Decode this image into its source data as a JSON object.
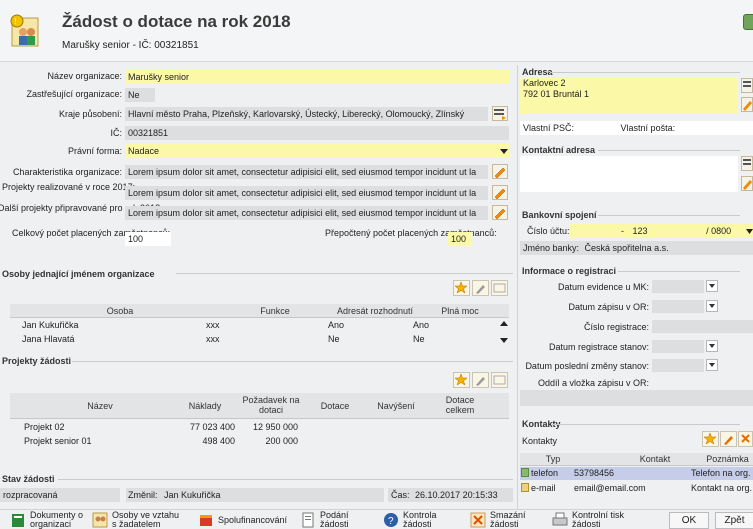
{
  "header": {
    "title": "Žádost o dotace na rok 2018",
    "subtitle": "Marušky senior - IČ: 00321851"
  },
  "org": {
    "nazev_label": "Název organizace:",
    "nazev": "Marušky senior",
    "zastr_label": "Zastřešující organizace:",
    "zastr": "Ne",
    "kraje_label": "Kraje působení:",
    "kraje": "Hlavní město Praha, Plzeňský, Karlovarský, Ústecký, Liberecký, Olomoucký, Zlínský",
    "ic_label": "IČ:",
    "ic": "00321851",
    "forma_label": "Právní forma:",
    "forma": "Nadace",
    "char_label": "Charakteristika organizace:",
    "char": "Lorem ipsum dolor sit amet, consectetur adipisici elit, sed eiusmod tempor incidunt ut la",
    "proj_label": "Projekty realizované v roce 2017:",
    "proj": "Lorem ipsum dolor sit amet, consectetur adipisici elit, sed eiusmod tempor incidunt ut la",
    "dalsi_label": "Další projekty připravované pro rok 2018:",
    "dalsi": "Lorem ipsum dolor sit amet, consectetur adipisici elit, sed eiusmod tempor incidunt ut la",
    "celk_label": "Celkový počet placených zaměstnanců:",
    "celk": "100",
    "prep_label": "Přepočtený počet placených zaměstnanců:",
    "prep": "100"
  },
  "osoby": {
    "title": "Osoby jednající jménem organizace",
    "cols": [
      "Osoba",
      "Funkce",
      "Adresát rozhodnutí",
      "Plná moc"
    ],
    "rows": [
      [
        "Jan Kukuřička",
        "xxx",
        "Ano",
        "Ano"
      ],
      [
        "Jana Hlavatá",
        "xxx",
        "Ne",
        "Ne"
      ]
    ]
  },
  "projekty": {
    "title": "Projekty žádosti",
    "cols": [
      "Název",
      "Náklady",
      "Požadavek na dotaci",
      "Dotace",
      "Navýšení",
      "Dotace celkem"
    ],
    "rows": [
      [
        "Projekt 02",
        "77 023 400",
        "12 950 000",
        "",
        "",
        ""
      ],
      [
        "Projekt senior 01",
        "498 400",
        "200 000",
        "",
        "",
        ""
      ]
    ]
  },
  "stav": {
    "title": "Stav žádosti",
    "value": "rozpracovaná",
    "zmenil_label": "Změnil:",
    "zmenil": "Jan Kukuřička",
    "cas_label": "Čas:",
    "cas": "26.10.2017 20:15:33"
  },
  "adresa": {
    "title": "Adresa",
    "line1": "Karlovec 2",
    "line2": "792 01 Bruntál 1",
    "psc_label": "Vlastní PSČ:",
    "posta_label": "Vlastní pošta:"
  },
  "kontaktni": {
    "title": "Kontaktní adresa"
  },
  "banka": {
    "title": "Bankovní spojení",
    "cislo_label": "Číslo účtu:",
    "prefix": "-",
    "cislo": "123",
    "kod": "/ 0800",
    "jmeno_label": "Jméno banky:",
    "jmeno": "Česká spořitelna a.s."
  },
  "registrace": {
    "title": "Informace o registraci",
    "l1": "Datum evidence u MK:",
    "l2": "Datum zápisu v OR:",
    "l3": "Číslo registrace:",
    "l4": "Datum registrace stanov:",
    "l5": "Datum poslední změny stanov:",
    "l6": "Oddíl a vložka zápisu v OR:"
  },
  "kontakty": {
    "title": "Kontakty",
    "sub": "Kontakty",
    "cols": [
      "Typ",
      "Kontakt",
      "Poznámka"
    ],
    "rows": [
      [
        "telefon",
        "53798456",
        "Telefon na org."
      ],
      [
        "e-mail",
        "email@email.com",
        "Kontakt na org."
      ]
    ]
  },
  "bottom": {
    "dokumenty": "Dokumenty o organizaci",
    "osoby": "Osoby ve vztahu s žadatelem",
    "spolu": "Spolufinancování",
    "podani": "Podání žádosti",
    "kontrola": "Kontrola žádosti",
    "smazani": "Smazání žádosti",
    "tisk": "Kontrolní tisk žádosti",
    "ok": "OK",
    "zpet": "Zpět"
  },
  "colors": {
    "yellow": "#fbf8a8",
    "gray": "#dcdedf",
    "accent": "#f08a00"
  }
}
